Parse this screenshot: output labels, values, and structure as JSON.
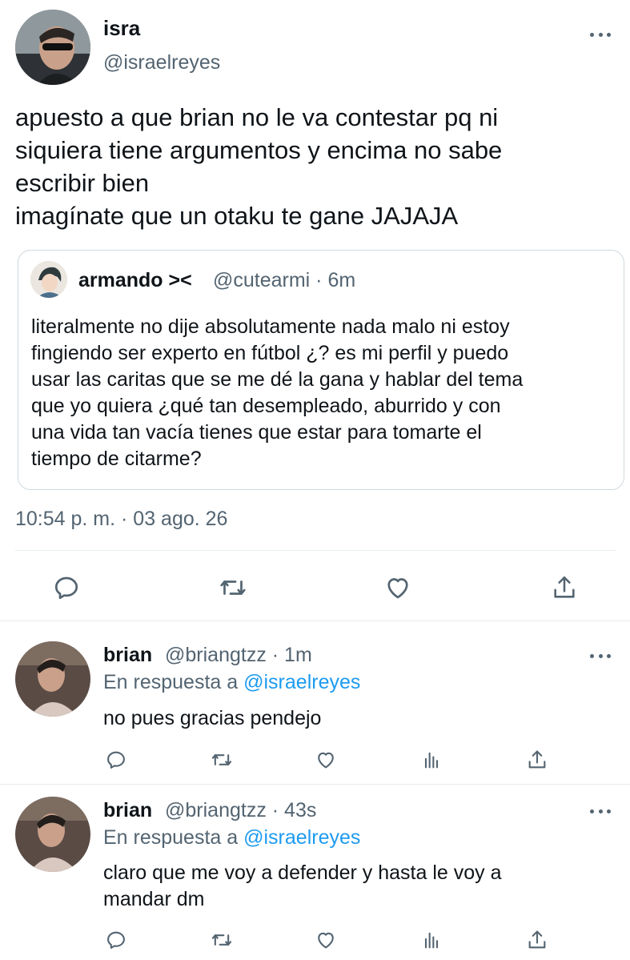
{
  "main_tweet": {
    "display_name": "isra",
    "handle": "@israelreyes",
    "text_lines": [
      "apuesto a que brian no le va contestar pq ni",
      "siquiera tiene argumentos y encima no sabe",
      "escribir bien",
      "imagínate que un otaku te gane JAJAJA"
    ],
    "timestamp": "10:54 p. m. · 03 ago. 26"
  },
  "quoted_tweet": {
    "display_name": "armando ><",
    "handle_time": "@cutearmi · 6m",
    "text_lines": [
      "literalmente no dije absolutamente nada malo ni estoy",
      "fingiendo ser experto en fútbol ¿? es mi perfil y puedo",
      "usar las caritas que se me dé la gana y hablar del tema",
      "que yo quiera ¿qué tan desempleado, aburrido y con",
      "una vida tan vacía tienes que estar para tomarte el",
      "tiempo de citarme?"
    ]
  },
  "replies": [
    {
      "display_name": "brian",
      "handle_time": "@briangtzz · 1m",
      "reply_prefix": "En respuesta a",
      "reply_to": "@israelreyes",
      "text_lines": [
        "no pues gracias pendejo"
      ]
    },
    {
      "display_name": "brian",
      "handle_time": "@briangtzz · 43s",
      "reply_prefix": "En respuesta a",
      "reply_to": "@israelreyes",
      "text_lines": [
        "claro que me voy a defender y hasta le voy a",
        "mandar dm"
      ]
    }
  ],
  "icons": [
    "reply-icon",
    "retweet-icon",
    "like-icon",
    "share-icon",
    "analytics-icon",
    "more-icon"
  ],
  "colors": {
    "text": "#0f1419",
    "muted": "#536471",
    "link": "#1d9bf0",
    "divider": "#e6ecf0"
  }
}
